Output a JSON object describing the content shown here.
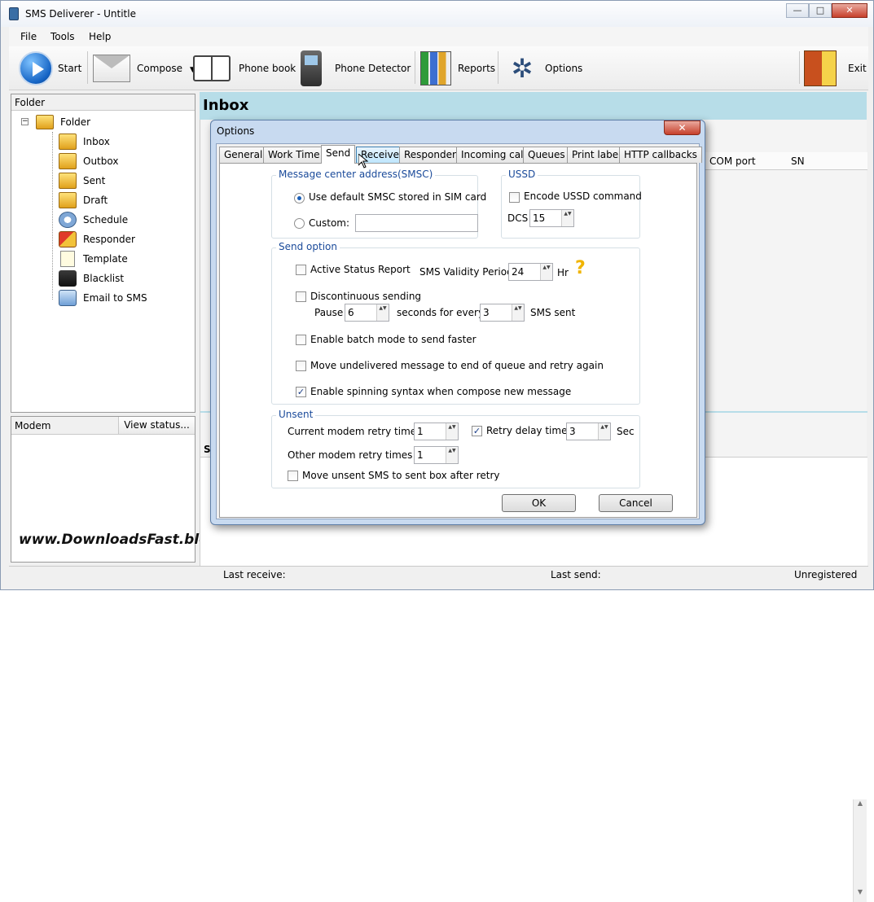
{
  "window": {
    "title": "SMS Deliverer - Untitle",
    "min": "—",
    "max": "□",
    "close": "✕"
  },
  "menu": {
    "file": "File",
    "tools": "Tools",
    "help": "Help"
  },
  "toolbar": {
    "start": "Start",
    "compose": "Compose",
    "compose_arrow": "▼",
    "phonebook": "Phone book",
    "detector": "Phone Detector",
    "reports": "Reports",
    "options": "Options",
    "options_glyph": "✲",
    "exit": "Exit"
  },
  "folders": {
    "header": "Folder",
    "toggle": "−",
    "root": "Folder",
    "items": [
      "Inbox",
      "Outbox",
      "Sent",
      "Draft",
      "Schedule",
      "Responder",
      "Template",
      "Blacklist",
      "Email to SMS"
    ]
  },
  "modem": {
    "label": "Modem",
    "view_status": "View status..."
  },
  "watermark": "www.DownloadsFast.blogspot.com",
  "inbox": {
    "title": "Inbox",
    "columns": [
      "COM port",
      "SN"
    ],
    "lower_label": "S"
  },
  "status": {
    "receive": "Last receive:",
    "send": "Last send:",
    "reg": "Unregistered",
    "scroll_up": "▲",
    "scroll_down": "▼"
  },
  "dialog": {
    "title": "Options",
    "close": "✕",
    "tabs": [
      "General",
      "Work Time",
      "Send",
      "Receive",
      "Responder",
      "Incoming call",
      "Queues",
      "Print label",
      "HTTP callbacks"
    ],
    "active_tab": "Send",
    "smsc": {
      "title": "Message center address(SMSC)",
      "use_default": "Use default SMSC stored in SIM card",
      "custom": "Custom:",
      "custom_value": ""
    },
    "ussd": {
      "title": "USSD",
      "encode": "Encode USSD command",
      "dcs_label": "DCS",
      "dcs_value": "15"
    },
    "send_option": {
      "title": "Send option",
      "active_status": "Active Status Report",
      "validity_label": "SMS Validity Period",
      "validity_value": "24",
      "validity_unit": "Hr",
      "help_glyph": "?",
      "discontinuous": "Discontinuous sending",
      "pause_label": "Pause",
      "pause_value": "6",
      "seconds_label": "seconds for every",
      "every_value": "3",
      "sms_sent": "SMS sent",
      "batch": "Enable batch mode to send faster",
      "move_undelivered": "Move undelivered message to end of queue and retry again",
      "spinning": "Enable spinning syntax when compose new message"
    },
    "unsent": {
      "title": "Unsent",
      "current_label": "Current modem retry times",
      "current_value": "1",
      "retry_delay": "Retry delay time",
      "delay_value": "3",
      "sec": "Sec",
      "other_label": "Other modem retry times",
      "other_value": "1",
      "move_unsent": "Move unsent SMS to sent box after retry"
    },
    "ok": "OK",
    "cancel": "Cancel",
    "spin_arrows": "▲▼"
  }
}
